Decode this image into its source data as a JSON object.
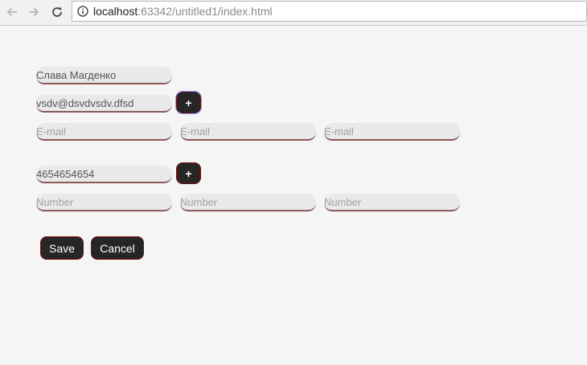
{
  "browser": {
    "url_host": "localhost",
    "url_rest": ":63342/untitled1/index.html",
    "back_icon": "arrow-left-icon",
    "forward_icon": "arrow-right-icon",
    "reload_icon": "reload-icon",
    "info_icon": "info-icon"
  },
  "form": {
    "name_value": "Слава Магденко",
    "email_value": "vsdv@dsvdvsdv.dfsd",
    "email_add_label": "+",
    "email_placeholders": [
      "E-mail",
      "E-mail",
      "E-mail"
    ],
    "phone_value": "4654654654",
    "phone_add_label": "+",
    "phone_placeholders": [
      "Number",
      "Number",
      "Number"
    ],
    "save_label": "Save",
    "cancel_label": "Cancel"
  },
  "colors": {
    "page_bg": "#f5f5f5",
    "field_bg": "#e9e9e9",
    "field_underline": "#8a5a5a",
    "button_bg": "#262626",
    "button_border": "#7a0f0f"
  }
}
